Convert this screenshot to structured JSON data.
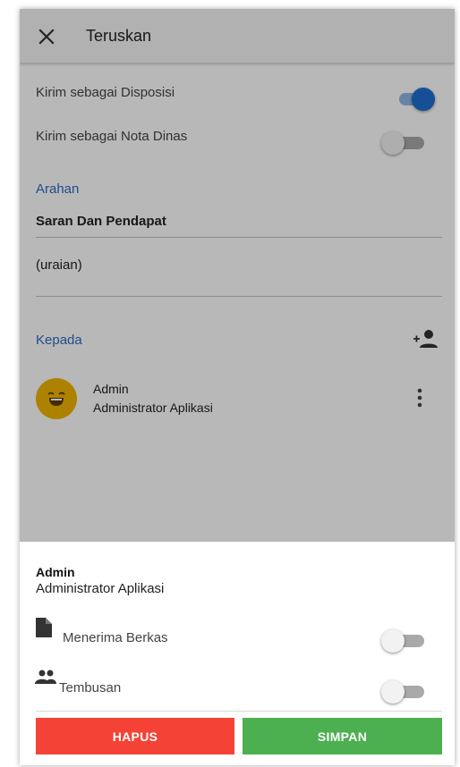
{
  "appbar": {
    "title": "Teruskan"
  },
  "options": {
    "disposisi_label": "Kirim sebagai Disposisi",
    "disposisi_on": true,
    "nota_dinas_label": "Kirim sebagai Nota Dinas",
    "nota_dinas_on": false
  },
  "arahan": {
    "heading": "Arahan",
    "value": "Saran Dan Pendapat",
    "uraian": "(uraian)"
  },
  "kepada": {
    "heading": "Kepada",
    "recipients": [
      {
        "name": "Admin",
        "role": "Administrator Aplikasi"
      }
    ]
  },
  "sheet": {
    "name": "Admin",
    "role": "Administrator Aplikasi",
    "menerima_berkas_label": "Menerima Berkas",
    "menerima_berkas_on": false,
    "tembusan_label": "Tembusan",
    "tembusan_on": false,
    "delete_label": "HAPUS",
    "save_label": "SIMPAN"
  },
  "colors": {
    "accent": "#1e6fd0",
    "delete": "#f44336",
    "save": "#4caf50",
    "avatar": "#f0b400"
  },
  "icons": [
    "close-icon",
    "add-person-icon",
    "emoji-face-icon",
    "more-vert-icon",
    "file-icon",
    "group-icon"
  ]
}
